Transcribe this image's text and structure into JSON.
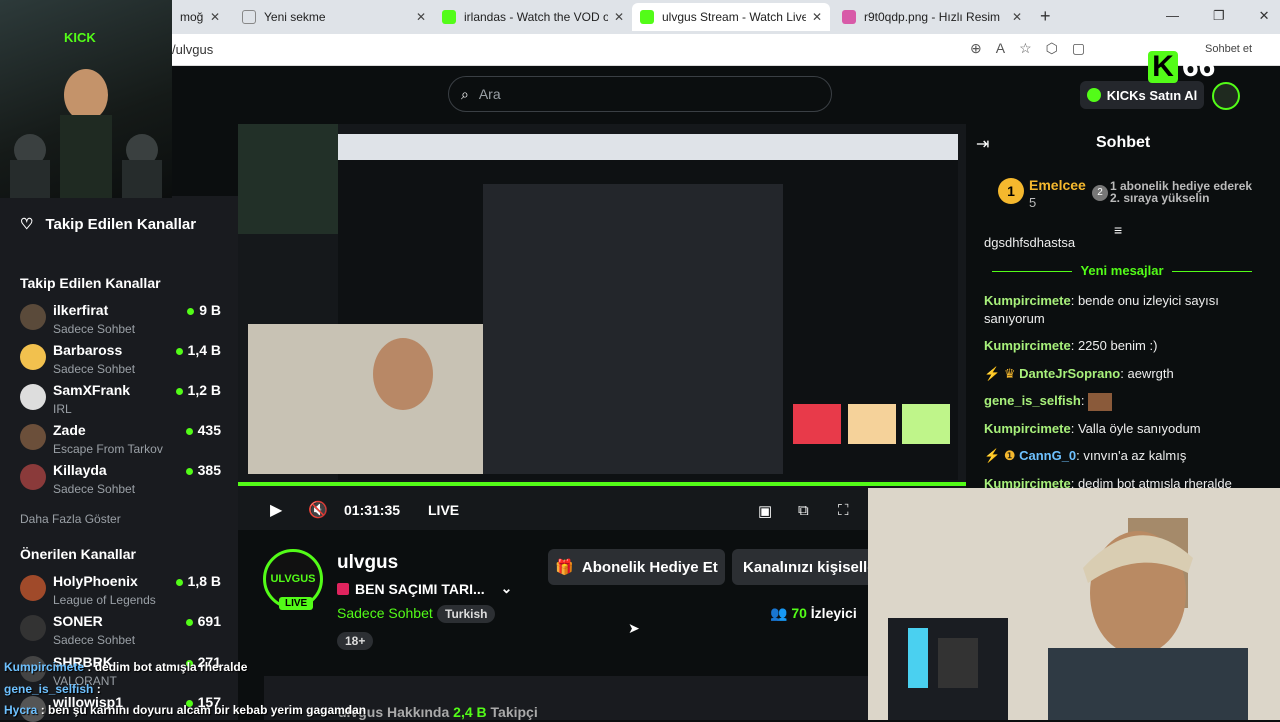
{
  "browser": {
    "tabs": [
      {
        "title": "moğlu (T",
        "active": false
      },
      {
        "title": "Yeni sekme",
        "active": false
      },
      {
        "title": "irlandas - Watch the VOD on Kick",
        "active": false
      },
      {
        "title": "ulvgus Stream - Watch Live on Kick",
        "active": true
      },
      {
        "title": "r9t0qdp.png - Hızlı Resim",
        "active": false
      }
    ],
    "url": "/ulvgus",
    "signin": "Sohbet et"
  },
  "kick_counter": "66",
  "header": {
    "search_placeholder": "Ara",
    "buy_label": "KICKs Satın Al"
  },
  "sidebar": {
    "following_label": "Takip Edilen Kanallar",
    "section_title": "Takip Edilen Kanallar",
    "channels": [
      {
        "name": "ilkerfirat",
        "category": "Sadece Sohbet",
        "viewers": "9 B"
      },
      {
        "name": "Barbaross",
        "category": "Sadece Sohbet",
        "viewers": "1,4 B"
      },
      {
        "name": "SamXFrank",
        "category": "IRL",
        "viewers": "1,2 B"
      },
      {
        "name": "Zade",
        "category": "Escape From Tarkov",
        "viewers": "435"
      },
      {
        "name": "Killayda",
        "category": "Sadece Sohbet",
        "viewers": "385"
      }
    ],
    "show_more": "Daha Fazla Göster",
    "recommended_title": "Önerilen Kanallar",
    "recommended": [
      {
        "name": "HolyPhoenix",
        "category": "League of Legends",
        "viewers": "1,8 B"
      },
      {
        "name": "SONER",
        "category": "Sadece Sohbet",
        "viewers": "691"
      },
      {
        "name": "SHRBRK",
        "category": "VALORANT",
        "viewers": "271"
      },
      {
        "name": "willowisp1",
        "category": "",
        "viewers": "157"
      }
    ]
  },
  "player": {
    "time": "01:31:35",
    "live_label": "LIVE",
    "progress": 1.0
  },
  "channel": {
    "name": "ulvgus",
    "avatar_text": "ULVGUS",
    "live_badge": "LIVE",
    "stream_title": "BEN SAÇIMI TARI...",
    "category": "Sadece Sohbet",
    "language": "Turkish",
    "age": "18+",
    "gift_btn": "Abonelik Hediye Et",
    "customize_btn": "Kanalınızı kişiselleştirin",
    "viewers_num": "70",
    "viewers_label": "İzleyici",
    "about_label": "ulvgus Hakkında",
    "followers_num": "2,4 B",
    "followers_label": "Takipçi"
  },
  "chat": {
    "title": "Sohbet",
    "leader": {
      "rank": "1",
      "name": "Emelcee",
      "count": "5",
      "next_rank": "2",
      "text": "1 abonelik hediye ederek 2. sıraya yükselin"
    },
    "prev_msg": "dgsdhfsdhastsa",
    "new_messages": "Yeni mesajlar",
    "messages": [
      {
        "user": "Kumpircimete",
        "text": "bende onu izleyici sayısı sanıyorum"
      },
      {
        "user": "Kumpircimete",
        "text": "2250 benim :)"
      },
      {
        "user": "DanteJrSoprano",
        "text": "aewrgth"
      },
      {
        "user": "gene_is_selfish",
        "text": ""
      },
      {
        "user": "Kumpircimete",
        "text": "Valla öyle sanıyodum"
      },
      {
        "user": "CannG_0",
        "text": "vınvın'a az kalmış"
      },
      {
        "user": "Kumpircimete",
        "text": "dedim bot atmışla rheralde"
      }
    ]
  },
  "overlay_chat": [
    {
      "user": "Kumpircimete",
      "text": ": dedim bot atmışla rheralde"
    },
    {
      "user": "gene_is_selfish",
      "text": ":"
    },
    {
      "user": "Hycra",
      "text": ": ben şu karnını doyuru alcam bir kebab yerim gagamdan"
    }
  ]
}
